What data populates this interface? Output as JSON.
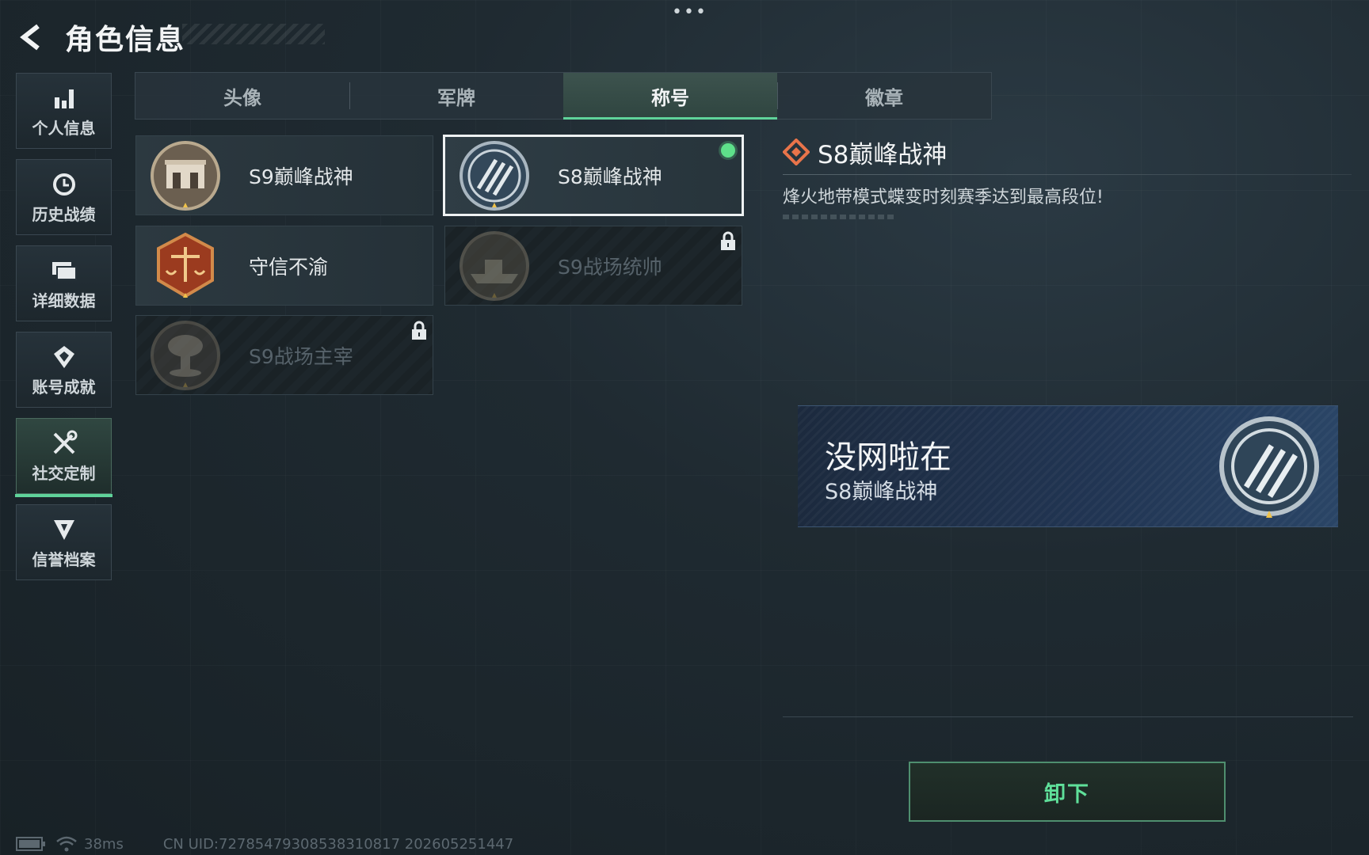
{
  "header": {
    "title": "角色信息"
  },
  "sidebar": {
    "items": [
      {
        "label": "个人信息",
        "icon": "bar-chart-icon"
      },
      {
        "label": "历史战绩",
        "icon": "history-clock-icon"
      },
      {
        "label": "详细数据",
        "icon": "folder-icon"
      },
      {
        "label": "账号成就",
        "icon": "achievement-badge-icon"
      },
      {
        "label": "社交定制",
        "icon": "tools-icon",
        "active": true
      },
      {
        "label": "信誉档案",
        "icon": "reputation-shield-icon"
      }
    ]
  },
  "tabs": [
    {
      "label": "头像"
    },
    {
      "label": "军牌"
    },
    {
      "label": "称号",
      "active": true
    },
    {
      "label": "徽章"
    }
  ],
  "titles": [
    {
      "label": "S9巅峰战神",
      "state": "unlocked",
      "medal": "fortress-medal"
    },
    {
      "label": "S8巅峰战神",
      "state": "selected-equipped",
      "medal": "wings-medal"
    },
    {
      "label": "守信不渝",
      "state": "unlocked",
      "medal": "scales-medal"
    },
    {
      "label": "S9战场统帅",
      "state": "locked",
      "medal": "warship-medal"
    },
    {
      "label": "S9战场主宰",
      "state": "locked",
      "medal": "mushroom-cloud-medal"
    }
  ],
  "detail": {
    "title": "S8巅峰战神",
    "description": "烽火地带模式蝶变时刻赛季达到最高段位!"
  },
  "preview": {
    "player_name": "没网啦在",
    "title": "S8巅峰战神"
  },
  "actions": {
    "unequip_label": "卸下"
  },
  "status_bar": {
    "ping": "38ms",
    "uid": "CN UID:72785479308538310817 202605251447"
  },
  "colors": {
    "accent": "#5fd39a",
    "equipped": "#5ee08a",
    "preview_bg": "#213553"
  }
}
